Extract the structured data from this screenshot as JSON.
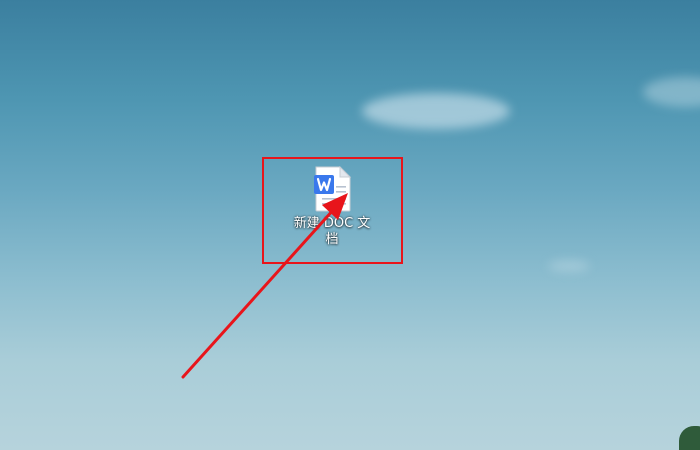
{
  "desktop": {
    "icons": [
      {
        "label": "新建 DOC 文档",
        "icon": "wps-writer-document-icon"
      }
    ]
  },
  "annotations": {
    "highlight_color": "#e8151b",
    "arrow_color": "#e8151b"
  }
}
